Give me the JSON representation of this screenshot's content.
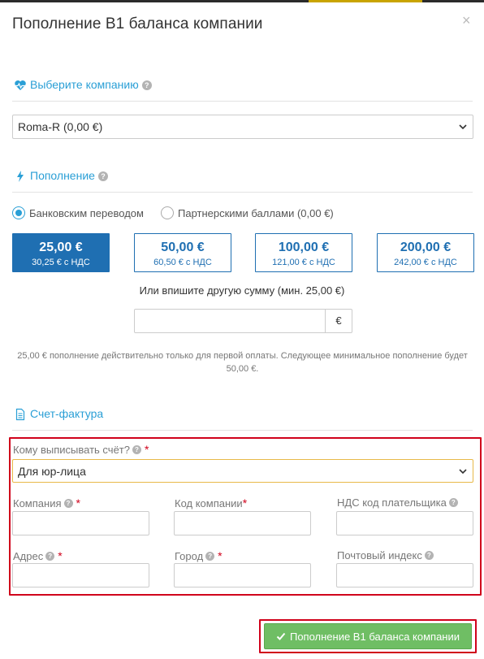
{
  "modal": {
    "title": "Пополнение B1 баланса компании",
    "close": "×"
  },
  "company_section": {
    "title": "Выберите компанию",
    "help": "?",
    "icon": "heartbeat-icon",
    "selected": "Roma-R (0,00 €)"
  },
  "topup_section": {
    "title": "Пополнение",
    "help": "?",
    "icon": "bolt-icon",
    "methods": [
      {
        "label": "Банковским переводом",
        "selected": true
      },
      {
        "label": "Партнерскими баллами (0,00 €)",
        "selected": false
      }
    ],
    "amounts": [
      {
        "value": "25,00 €",
        "vat": "30,25 € с НДС",
        "active": true
      },
      {
        "value": "50,00 €",
        "vat": "60,50 € с НДС",
        "active": false
      },
      {
        "value": "100,00 €",
        "vat": "121,00 € с НДС",
        "active": false
      },
      {
        "value": "200,00 €",
        "vat": "242,00 € с НДС",
        "active": false
      }
    ],
    "other_amount_label": "Или впишите другую сумму (мин. 25,00 €)",
    "currency_addon": "€",
    "note": "25,00 € пополнение действительно только для первой оплаты. Следующее минимальное пополнение будет 50,00 €."
  },
  "invoice_section": {
    "title": "Счет-фактура",
    "icon": "document-icon",
    "recipient_label": "Кому выписывать счёт?",
    "recipient_value": "Для юр-лица",
    "fields": {
      "company": "Компания",
      "company_code": "Код компании",
      "vat_code": "НДС код плательщика",
      "address": "Адрес",
      "city": "Город",
      "postal": "Почтовый индекс"
    },
    "help": "?",
    "required_mark": "*"
  },
  "submit": {
    "label": "Пополнение B1 баланса компании",
    "icon": "check-icon"
  },
  "colors": {
    "accent": "#2a9fd6",
    "primary": "#1f6fb2",
    "success": "#6fbe64",
    "highlight": "#d0021b"
  }
}
